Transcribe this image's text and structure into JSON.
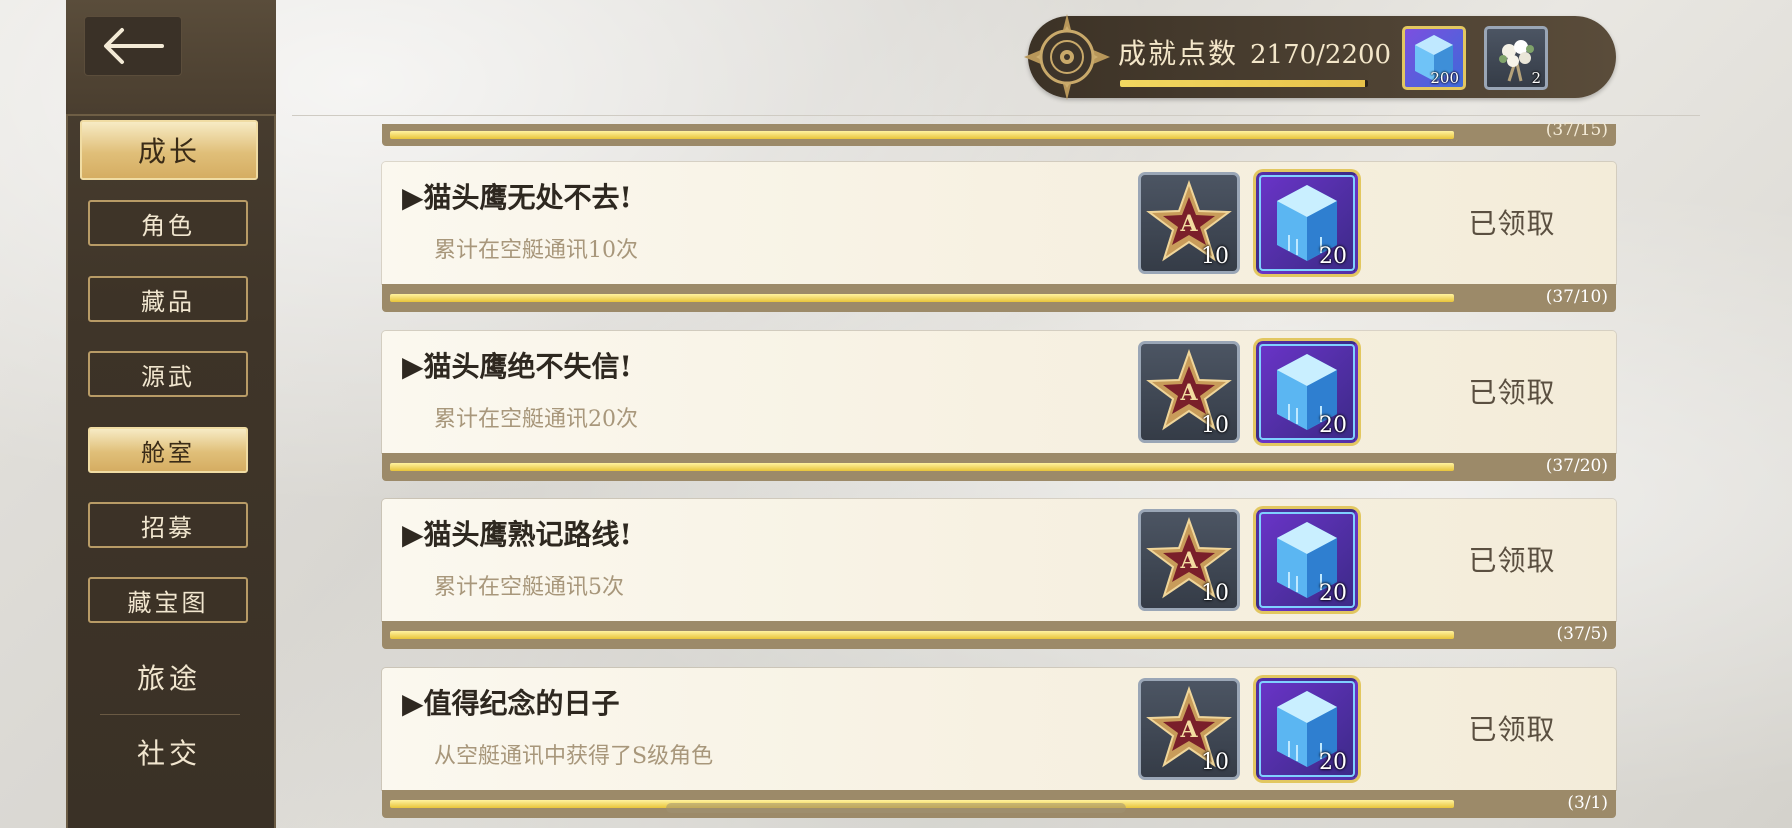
{
  "sidebar": {
    "items": [
      {
        "label": "成长",
        "active": true,
        "style": "big"
      },
      {
        "label": "角色",
        "active": false
      },
      {
        "label": "藏品",
        "active": false
      },
      {
        "label": "源武",
        "active": false
      },
      {
        "label": "舱室",
        "active": true
      },
      {
        "label": "招募",
        "active": false
      },
      {
        "label": "藏宝图",
        "active": false
      },
      {
        "label": "旅途",
        "active": false,
        "style": "plain"
      },
      {
        "label": "社交",
        "active": false,
        "style": "plain"
      }
    ]
  },
  "header": {
    "points_label": "成就点数",
    "points_value": "2170/2200",
    "points_progress": 0.986,
    "items": [
      {
        "icon": "blue-crystal-icon",
        "qty": "200"
      },
      {
        "icon": "flower-bouquet-icon",
        "qty": "2"
      }
    ]
  },
  "partial_card": {
    "count": "(37/15)",
    "progress": 1.0
  },
  "achievements": [
    {
      "title": "▶猫头鹰无处不去!",
      "desc": "累计在空艇通讯10次",
      "rewards": [
        {
          "icon": "a-rank-star-badge-icon",
          "qty": "10"
        },
        {
          "icon": "blue-crystal-icon",
          "qty": "20"
        }
      ],
      "status": "已领取",
      "count": "(37/10)",
      "progress": 1.0
    },
    {
      "title": "▶猫头鹰绝不失信!",
      "desc": "累计在空艇通讯20次",
      "rewards": [
        {
          "icon": "a-rank-star-badge-icon",
          "qty": "10"
        },
        {
          "icon": "blue-crystal-icon",
          "qty": "20"
        }
      ],
      "status": "已领取",
      "count": "(37/20)",
      "progress": 1.0
    },
    {
      "title": "▶猫头鹰熟记路线!",
      "desc": "累计在空艇通讯5次",
      "rewards": [
        {
          "icon": "a-rank-star-badge-icon",
          "qty": "10"
        },
        {
          "icon": "blue-crystal-icon",
          "qty": "20"
        }
      ],
      "status": "已领取",
      "count": "(37/5)",
      "progress": 1.0
    },
    {
      "title": "▶值得纪念的日子",
      "desc": "从空艇通讯中获得了S级角色",
      "rewards": [
        {
          "icon": "a-rank-star-badge-icon",
          "qty": "10"
        },
        {
          "icon": "blue-crystal-icon",
          "qty": "20"
        }
      ],
      "status": "已领取",
      "count": "(3/1)",
      "progress": 1.0
    }
  ],
  "colors": {
    "accent_gold": "#e7c24a",
    "sidebar_bg": "#3f3529",
    "active_tab": "#e0bf79"
  }
}
